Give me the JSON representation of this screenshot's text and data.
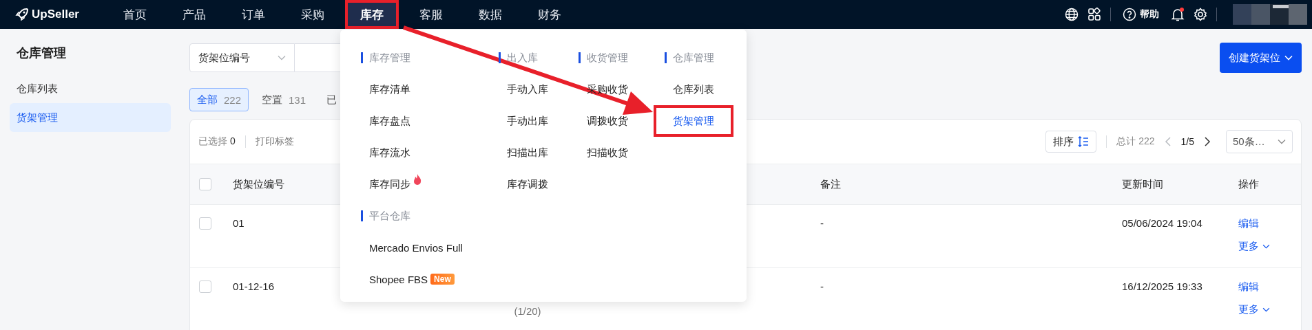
{
  "brand": {
    "name": "UpSeller"
  },
  "nav": [
    {
      "label": "首页",
      "selected": false,
      "highlighted": false
    },
    {
      "label": "产品",
      "selected": false,
      "highlighted": false
    },
    {
      "label": "订单",
      "selected": false,
      "highlighted": false
    },
    {
      "label": "采购",
      "selected": false,
      "highlighted": false
    },
    {
      "label": "库存",
      "selected": true,
      "highlighted": true
    },
    {
      "label": "客服",
      "selected": false,
      "highlighted": false
    },
    {
      "label": "数据",
      "selected": false,
      "highlighted": false
    },
    {
      "label": "财务",
      "selected": false,
      "highlighted": false
    }
  ],
  "header_actions": {
    "help": "帮助",
    "notification_dot": true
  },
  "sidebar": {
    "title": "仓库管理",
    "items": [
      {
        "label": "仓库列表",
        "selected": false
      },
      {
        "label": "货架管理",
        "selected": true
      }
    ]
  },
  "filter": {
    "field_select": "货架位编号"
  },
  "create_button": "创建货架位",
  "status_tabs": [
    {
      "label": "全部",
      "count": "222",
      "selected": true
    },
    {
      "label": "空置",
      "count": "131",
      "selected": false
    },
    {
      "label": "已",
      "selected": false
    }
  ],
  "toolbar": {
    "selected_label": "已选择",
    "selected_count": "0",
    "print_button": "打印标签",
    "sort_button": "排序",
    "total": "总计 222",
    "page": "1/5",
    "page_size": "50条…"
  },
  "table": {
    "select_all_checked": false,
    "columns": [
      {
        "label": "货架位编号"
      },
      {
        "label": "备注"
      },
      {
        "label": "更新时间"
      },
      {
        "label": "操作"
      }
    ],
    "rows": [
      {
        "checked": false,
        "code": "01",
        "note": "-",
        "updated": "05/06/2024 19:04",
        "actions": [
          {
            "label": "编辑",
            "kind": "link"
          },
          {
            "label": "更多",
            "kind": "menu"
          }
        ]
      },
      {
        "checked": false,
        "code": "01-12-16",
        "column_3": "(1/20)",
        "note": "-",
        "updated": "16/12/2025 19:33",
        "actions": [
          {
            "label": "编辑",
            "kind": "link"
          },
          {
            "label": "更多",
            "kind": "menu"
          }
        ]
      }
    ]
  },
  "menu": {
    "columns": [
      {
        "sections": [
          {
            "title": "库存管理",
            "items": [
              {
                "label": "库存清单",
                "selected": false,
                "highlighted": false,
                "hot": false
              },
              {
                "label": "库存盘点",
                "selected": false,
                "highlighted": false,
                "hot": false
              },
              {
                "label": "库存流水",
                "selected": false,
                "highlighted": false,
                "hot": false
              },
              {
                "label": "库存同步",
                "selected": false,
                "highlighted": false,
                "hot": true
              }
            ]
          },
          {
            "title": "平台仓库",
            "items": [
              {
                "label": "Mercado Envios Full",
                "selected": false,
                "highlighted": false,
                "hot": false
              },
              {
                "label": "Shopee FBS",
                "selected": false,
                "highlighted": false,
                "hot": false,
                "badge": "New"
              }
            ]
          }
        ]
      },
      {
        "sections": [
          {
            "title": "出入库",
            "items": [
              {
                "label": "手动入库",
                "selected": false,
                "highlighted": false,
                "hot": false
              },
              {
                "label": "手动出库",
                "selected": false,
                "highlighted": false,
                "hot": false
              },
              {
                "label": "扫描出库",
                "selected": false,
                "highlighted": false,
                "hot": false
              },
              {
                "label": "库存调拨",
                "selected": false,
                "highlighted": false,
                "hot": false
              }
            ]
          }
        ]
      },
      {
        "sections": [
          {
            "title": "收货管理",
            "items": [
              {
                "label": "采购收货",
                "selected": false,
                "highlighted": false,
                "hot": false
              },
              {
                "label": "调拨收货",
                "selected": false,
                "highlighted": false,
                "hot": false
              },
              {
                "label": "扫描收货",
                "selected": false,
                "highlighted": false,
                "hot": false
              }
            ]
          }
        ]
      },
      {
        "sections": [
          {
            "title": "仓库管理",
            "items": [
              {
                "label": "仓库列表",
                "selected": false,
                "highlighted": false,
                "hot": false
              },
              {
                "label": "货架管理",
                "selected": true,
                "highlighted": true,
                "hot": false
              }
            ]
          }
        ]
      }
    ]
  }
}
